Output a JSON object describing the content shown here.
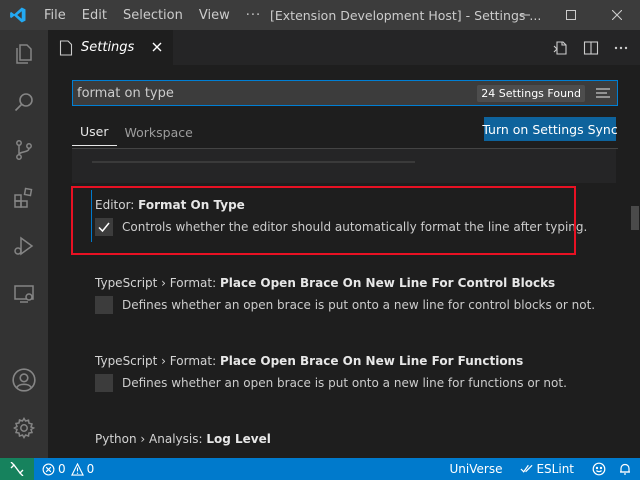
{
  "titlebar": {
    "menu": [
      "File",
      "Edit",
      "Selection",
      "View"
    ],
    "more": "···",
    "window_title": "[Extension Development Host] - Settings ..."
  },
  "tab": {
    "label": "Settings"
  },
  "search": {
    "value": "format on type",
    "found": "24 Settings Found"
  },
  "scopes": {
    "user": "User",
    "workspace": "Workspace"
  },
  "sync_button": "Turn on Settings Sync",
  "settings": [
    {
      "category": "Editor: ",
      "name": "Format On Type",
      "checked": true,
      "description": "Controls whether the editor should automatically format the line after typing."
    },
    {
      "category": "TypeScript › Format: ",
      "name": "Place Open Brace On New Line For Control Blocks",
      "checked": false,
      "description": "Defines whether an open brace is put onto a new line for control blocks or not."
    },
    {
      "category": "TypeScript › Format: ",
      "name": "Place Open Brace On New Line For Functions",
      "checked": false,
      "description": "Defines whether an open brace is put onto a new line for functions or not."
    },
    {
      "category": "Python › Analysis: ",
      "name": "Log Level"
    }
  ],
  "statusbar": {
    "errors": "0",
    "warnings": "0",
    "universe": "UniVerse",
    "eslint": "ESLint"
  },
  "colors": {
    "accent": "#007acc",
    "highlight": "#e81123",
    "sync_button": "#0e639c",
    "remote": "#16825d"
  },
  "icons": {
    "activity": [
      "explorer-icon",
      "search-icon",
      "source-control-icon",
      "extensions-icon",
      "run-debug-icon",
      "remote-explorer-icon",
      "account-icon",
      "gear-icon"
    ]
  }
}
